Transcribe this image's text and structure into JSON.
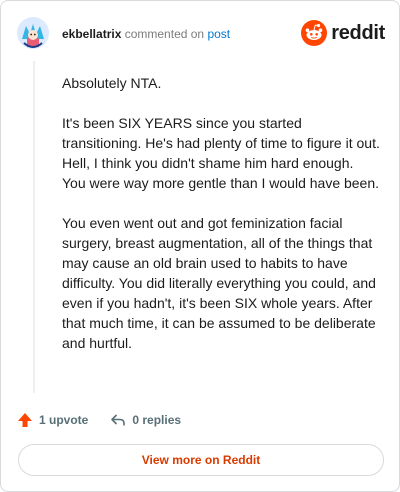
{
  "header": {
    "username": "ekbellatrix",
    "commented_text": "commented on",
    "post_link": "post",
    "brand": "reddit"
  },
  "comment": {
    "paragraphs": [
      "Absolutely NTA.",
      "It's been SIX YEARS since you started transitioning. He's had plenty of time to figure it out. Hell, I think you didn't shame him hard enough. You were way more gentle than I would have been.",
      "You even went out and got feminization facial surgery, breast augmentation, all of the things that may cause an old brain used to habits to have difficulty. You did literally everything you could, and even if you hadn't, it's been SIX whole years. After that much time, it can be assumed to be deliberate and hurtful."
    ]
  },
  "actions": {
    "upvote_label": "1 upvote",
    "replies_label": "0 replies"
  },
  "footer": {
    "view_more_label": "View more on Reddit"
  },
  "colors": {
    "brand_orange": "#ff4500",
    "link_blue": "#0079d3",
    "cta_orange": "#d93a00"
  },
  "icons": {
    "upvote": "upvote-arrow-icon",
    "reply": "reply-arrow-icon",
    "brand": "reddit-snoo-icon"
  }
}
